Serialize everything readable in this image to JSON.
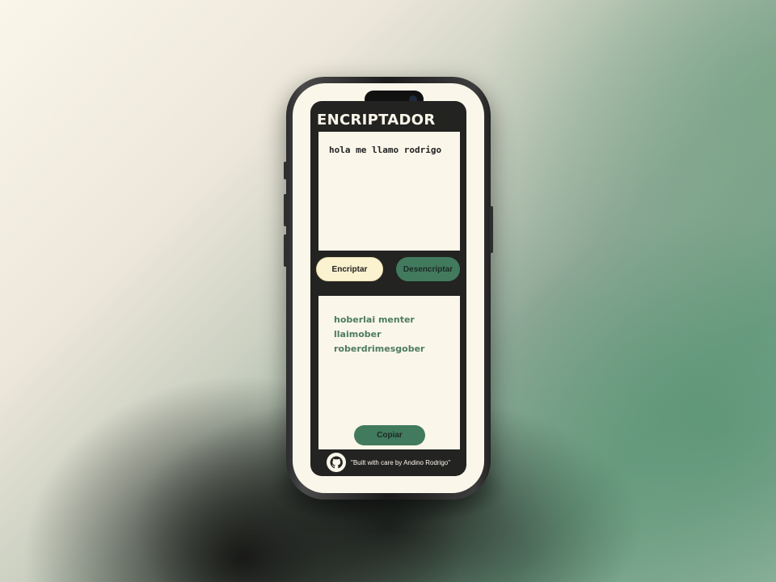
{
  "app": {
    "title": "ENCRIPTADOR"
  },
  "input": {
    "value": "hola me llamo rodrigo"
  },
  "buttons": {
    "encrypt_label": "Encriptar",
    "decrypt_label": "Desencriptar",
    "copy_label": "Copiar"
  },
  "output": {
    "lines": [
      "hoberlai menter llaimober",
      "roberdrimesgober"
    ]
  },
  "footer": {
    "text": "\"Built with care by Andino Rodrigo\"",
    "icon": "github-icon"
  },
  "colors": {
    "accent_green": "#427a5e",
    "cream": "#faf6ea",
    "button_cream": "#fbf2cf",
    "dark": "#232321",
    "output_text": "#4d7c61"
  }
}
